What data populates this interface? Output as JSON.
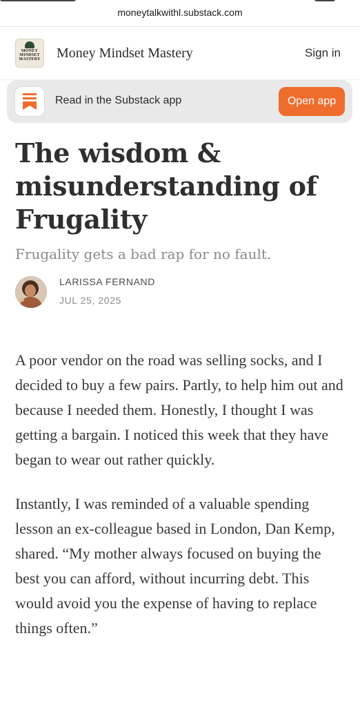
{
  "browser": {
    "url": "moneytalkwithl.substack.com"
  },
  "publication": {
    "name": "Money Mindset Mastery",
    "logo_lines": [
      "MONEY",
      "MINDSET",
      "MASTERY"
    ],
    "sign_in_label": "Sign in"
  },
  "app_banner": {
    "text": "Read in the Substack app",
    "button_label": "Open app",
    "accent_color": "#ee6d2c"
  },
  "article": {
    "title": "The wisdom & misunderstanding of Frugality",
    "subtitle": "Frugality gets a bad rap for no fault.",
    "author": "LARISSA FERNAND",
    "date": "JUL 25, 2025",
    "paragraphs": [
      "A poor vendor on the road was selling socks, and I decided to buy a few pairs. Partly, to help him out and because I needed them. Honestly, I thought I was getting a bargain. I noticed this week that they have began to wear out rather quickly.",
      "Instantly, I was reminded of a valuable spending lesson an ex-colleague based in London, Dan Kemp, shared. “My mother always focused on buying the best you can afford, without incurring debt. This would avoid you the expense of having to replace things often.”"
    ]
  }
}
